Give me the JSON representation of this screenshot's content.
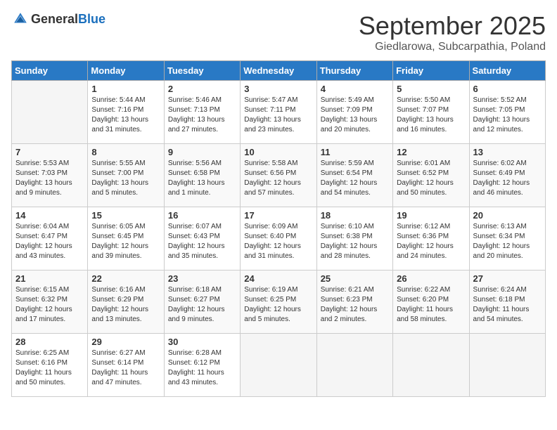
{
  "header": {
    "logo_general": "General",
    "logo_blue": "Blue",
    "month": "September 2025",
    "location": "Giedlarowa, Subcarpathia, Poland"
  },
  "weekdays": [
    "Sunday",
    "Monday",
    "Tuesday",
    "Wednesday",
    "Thursday",
    "Friday",
    "Saturday"
  ],
  "weeks": [
    [
      {
        "day": "",
        "info": ""
      },
      {
        "day": "1",
        "info": "Sunrise: 5:44 AM\nSunset: 7:16 PM\nDaylight: 13 hours\nand 31 minutes."
      },
      {
        "day": "2",
        "info": "Sunrise: 5:46 AM\nSunset: 7:13 PM\nDaylight: 13 hours\nand 27 minutes."
      },
      {
        "day": "3",
        "info": "Sunrise: 5:47 AM\nSunset: 7:11 PM\nDaylight: 13 hours\nand 23 minutes."
      },
      {
        "day": "4",
        "info": "Sunrise: 5:49 AM\nSunset: 7:09 PM\nDaylight: 13 hours\nand 20 minutes."
      },
      {
        "day": "5",
        "info": "Sunrise: 5:50 AM\nSunset: 7:07 PM\nDaylight: 13 hours\nand 16 minutes."
      },
      {
        "day": "6",
        "info": "Sunrise: 5:52 AM\nSunset: 7:05 PM\nDaylight: 13 hours\nand 12 minutes."
      }
    ],
    [
      {
        "day": "7",
        "info": "Sunrise: 5:53 AM\nSunset: 7:03 PM\nDaylight: 13 hours\nand 9 minutes."
      },
      {
        "day": "8",
        "info": "Sunrise: 5:55 AM\nSunset: 7:00 PM\nDaylight: 13 hours\nand 5 minutes."
      },
      {
        "day": "9",
        "info": "Sunrise: 5:56 AM\nSunset: 6:58 PM\nDaylight: 13 hours\nand 1 minute."
      },
      {
        "day": "10",
        "info": "Sunrise: 5:58 AM\nSunset: 6:56 PM\nDaylight: 12 hours\nand 57 minutes."
      },
      {
        "day": "11",
        "info": "Sunrise: 5:59 AM\nSunset: 6:54 PM\nDaylight: 12 hours\nand 54 minutes."
      },
      {
        "day": "12",
        "info": "Sunrise: 6:01 AM\nSunset: 6:52 PM\nDaylight: 12 hours\nand 50 minutes."
      },
      {
        "day": "13",
        "info": "Sunrise: 6:02 AM\nSunset: 6:49 PM\nDaylight: 12 hours\nand 46 minutes."
      }
    ],
    [
      {
        "day": "14",
        "info": "Sunrise: 6:04 AM\nSunset: 6:47 PM\nDaylight: 12 hours\nand 43 minutes."
      },
      {
        "day": "15",
        "info": "Sunrise: 6:05 AM\nSunset: 6:45 PM\nDaylight: 12 hours\nand 39 minutes."
      },
      {
        "day": "16",
        "info": "Sunrise: 6:07 AM\nSunset: 6:43 PM\nDaylight: 12 hours\nand 35 minutes."
      },
      {
        "day": "17",
        "info": "Sunrise: 6:09 AM\nSunset: 6:40 PM\nDaylight: 12 hours\nand 31 minutes."
      },
      {
        "day": "18",
        "info": "Sunrise: 6:10 AM\nSunset: 6:38 PM\nDaylight: 12 hours\nand 28 minutes."
      },
      {
        "day": "19",
        "info": "Sunrise: 6:12 AM\nSunset: 6:36 PM\nDaylight: 12 hours\nand 24 minutes."
      },
      {
        "day": "20",
        "info": "Sunrise: 6:13 AM\nSunset: 6:34 PM\nDaylight: 12 hours\nand 20 minutes."
      }
    ],
    [
      {
        "day": "21",
        "info": "Sunrise: 6:15 AM\nSunset: 6:32 PM\nDaylight: 12 hours\nand 17 minutes."
      },
      {
        "day": "22",
        "info": "Sunrise: 6:16 AM\nSunset: 6:29 PM\nDaylight: 12 hours\nand 13 minutes."
      },
      {
        "day": "23",
        "info": "Sunrise: 6:18 AM\nSunset: 6:27 PM\nDaylight: 12 hours\nand 9 minutes."
      },
      {
        "day": "24",
        "info": "Sunrise: 6:19 AM\nSunset: 6:25 PM\nDaylight: 12 hours\nand 5 minutes."
      },
      {
        "day": "25",
        "info": "Sunrise: 6:21 AM\nSunset: 6:23 PM\nDaylight: 12 hours\nand 2 minutes."
      },
      {
        "day": "26",
        "info": "Sunrise: 6:22 AM\nSunset: 6:20 PM\nDaylight: 11 hours\nand 58 minutes."
      },
      {
        "day": "27",
        "info": "Sunrise: 6:24 AM\nSunset: 6:18 PM\nDaylight: 11 hours\nand 54 minutes."
      }
    ],
    [
      {
        "day": "28",
        "info": "Sunrise: 6:25 AM\nSunset: 6:16 PM\nDaylight: 11 hours\nand 50 minutes."
      },
      {
        "day": "29",
        "info": "Sunrise: 6:27 AM\nSunset: 6:14 PM\nDaylight: 11 hours\nand 47 minutes."
      },
      {
        "day": "30",
        "info": "Sunrise: 6:28 AM\nSunset: 6:12 PM\nDaylight: 11 hours\nand 43 minutes."
      },
      {
        "day": "",
        "info": ""
      },
      {
        "day": "",
        "info": ""
      },
      {
        "day": "",
        "info": ""
      },
      {
        "day": "",
        "info": ""
      }
    ]
  ]
}
